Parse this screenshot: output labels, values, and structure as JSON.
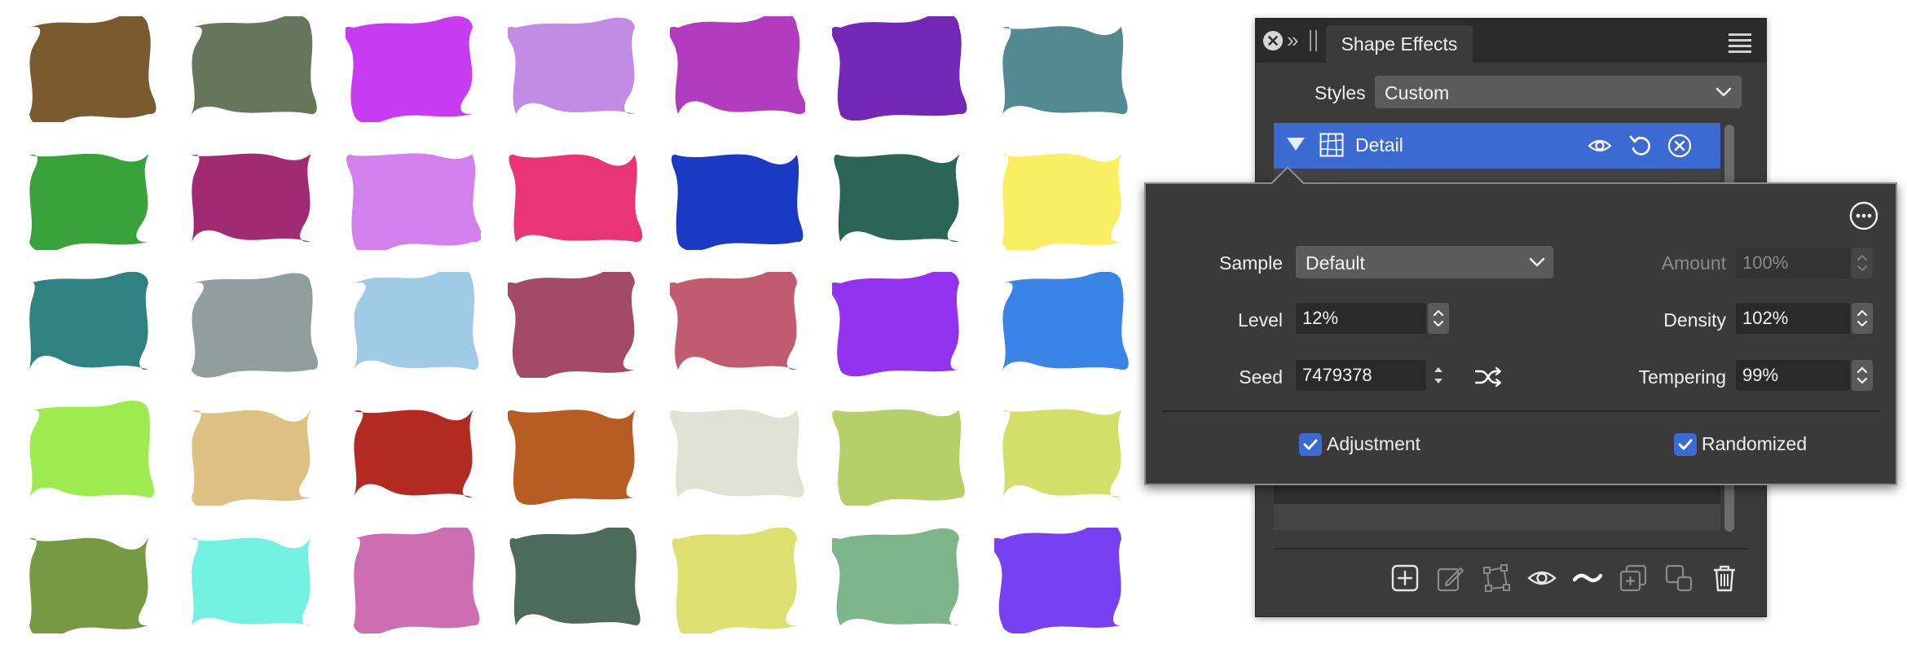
{
  "canvas": {
    "shape_colors": [
      [
        "#7a5a2f",
        "#66765d",
        "#c73cf0",
        "#c28ce4",
        "#b13cbe",
        "#7227b5",
        "#538a91"
      ],
      [
        "#3aa23a",
        "#a12b72",
        "#d280ee",
        "#e93476",
        "#1a3ac4",
        "#2b6654",
        "#f9ef62"
      ],
      [
        "#2f8280",
        "#909e9c",
        "#a0cbe6",
        "#a34a68",
        "#c15c6f",
        "#9433ee",
        "#3a84e8"
      ],
      [
        "#9deb4f",
        "#dcc182",
        "#b22a22",
        "#b75c23",
        "#e0e3d2",
        "#b5cf69",
        "#d2e06a"
      ],
      [
        "#769a44",
        "#72f1e1",
        "#cd6eb3",
        "#4d6b5b",
        "#dde06f",
        "#7db58b",
        "#7740f0"
      ]
    ]
  },
  "panel": {
    "tab_title": "Shape Effects",
    "styles_label": "Styles",
    "styles_value": "Custom",
    "effect_row": {
      "label": "Detail"
    },
    "icons": {
      "close": "close-icon",
      "collapse": "double-chevron-icon",
      "menu": "hamburger-menu-icon",
      "row": [
        "disclosure-triangle-icon",
        "texture-thumbnail-icon",
        "eye-icon",
        "reset-icon",
        "remove-icon"
      ],
      "toolbar": [
        "add-effect-icon",
        "edit-icon",
        "node-icon",
        "eye-icon",
        "wave-icon",
        "duplicate-icon",
        "copy-to-shape-icon",
        "trash-icon"
      ]
    }
  },
  "popover": {
    "sample_label": "Sample",
    "sample_value": "Default",
    "level_label": "Level",
    "level_value": "12%",
    "seed_label": "Seed",
    "seed_value": "7479378",
    "amount_label": "Amount",
    "amount_value": "100%",
    "density_label": "Density",
    "density_value": "102%",
    "tempering_label": "Tempering",
    "tempering_value": "99%",
    "adjustment_label": "Adjustment",
    "adjustment_checked": true,
    "randomized_label": "Randomized",
    "randomized_checked": true
  },
  "colors": {
    "accent": "#3b6ad3",
    "panel_bg": "#3b3b3b",
    "header_bg": "#2b2b2b"
  }
}
